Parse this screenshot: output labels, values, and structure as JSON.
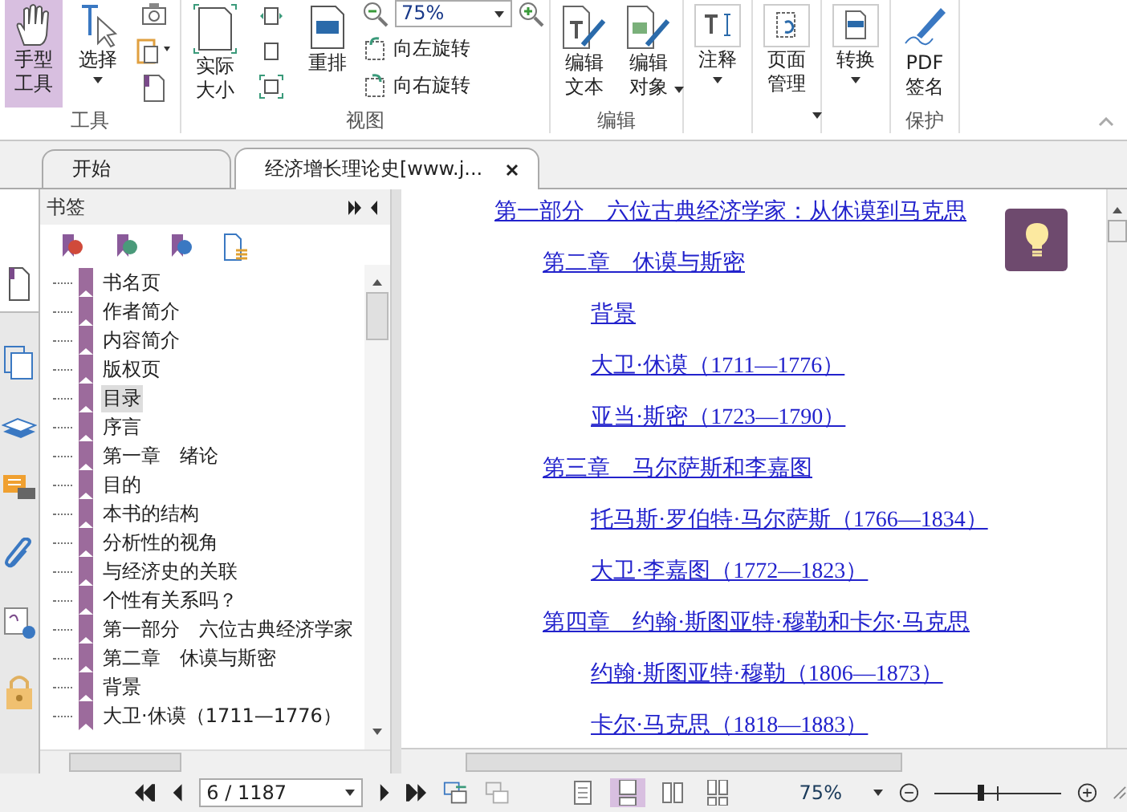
{
  "ribbon": {
    "tool_group": {
      "label": "工具",
      "hand_tool": {
        "label": "手型工具",
        "selected": true
      },
      "select_tool": {
        "label": "选择",
        "selected": false
      }
    },
    "view_group": {
      "label": "视图",
      "actual_size": "实际大小",
      "reflow": "重排",
      "zoom_value": "75%",
      "rotate_left": "向左旋转",
      "rotate_right": "向右旋转"
    },
    "edit_group": {
      "label": "编辑",
      "edit_text": "编辑文本",
      "edit_object": "编辑对象"
    },
    "annotate": "注释",
    "page_manage": "页面管理",
    "convert": "转换",
    "protect_group": {
      "label": "保护",
      "pdf_sign": "PDF\n签名"
    }
  },
  "tabs": [
    {
      "label": "开始",
      "selected": false
    },
    {
      "label": "经济增长理论史[www.j...",
      "selected": true
    }
  ],
  "bookmarks_panel": {
    "title": "书签",
    "items": [
      {
        "label": "书名页",
        "selected": false
      },
      {
        "label": "作者简介",
        "selected": false
      },
      {
        "label": "内容简介",
        "selected": false
      },
      {
        "label": "版权页",
        "selected": false
      },
      {
        "label": "目录",
        "selected": true
      },
      {
        "label": "序言",
        "selected": false
      },
      {
        "label": "第一章　绪论",
        "selected": false
      },
      {
        "label": "目的",
        "selected": false
      },
      {
        "label": "本书的结构",
        "selected": false
      },
      {
        "label": "分析性的视角",
        "selected": false
      },
      {
        "label": "与经济史的关联",
        "selected": false
      },
      {
        "label": "个性有关系吗？",
        "selected": false
      },
      {
        "label": "第一部分　六位古典经济学家",
        "selected": false
      },
      {
        "label": "第二章　休谟与斯密",
        "selected": false
      },
      {
        "label": "背景",
        "selected": false
      },
      {
        "label": "大卫·休谟（1711—1776）",
        "selected": false
      }
    ]
  },
  "document_toc": [
    {
      "label": "第一部分　六位古典经济学家：从休谟到马克思",
      "children": [
        {
          "label": "第二章　休谟与斯密",
          "children": [
            {
              "label": "背景"
            },
            {
              "label": "大卫·休谟（1711—1776）"
            },
            {
              "label": "亚当·斯密（1723—1790）"
            }
          ]
        },
        {
          "label": "第三章　马尔萨斯和李嘉图",
          "children": [
            {
              "label": "托马斯·罗伯特·马尔萨斯（1766—1834）"
            },
            {
              "label": "大卫·李嘉图（1772—1823）"
            }
          ]
        },
        {
          "label": "第四章　约翰·斯图亚特·穆勒和卡尔·马克思",
          "children": [
            {
              "label": "约翰·斯图亚特·穆勒（1806—1873）"
            },
            {
              "label": "卡尔·马克思（1818—1883）"
            }
          ]
        }
      ]
    }
  ],
  "status_bar": {
    "page_field": "6 / 1187",
    "zoom_value": "75%",
    "zoom_slider": {
      "level": 0.37
    },
    "view_modes": [
      {
        "selected": false
      },
      {
        "selected": true
      },
      {
        "selected": false
      },
      {
        "selected": false
      }
    ]
  }
}
